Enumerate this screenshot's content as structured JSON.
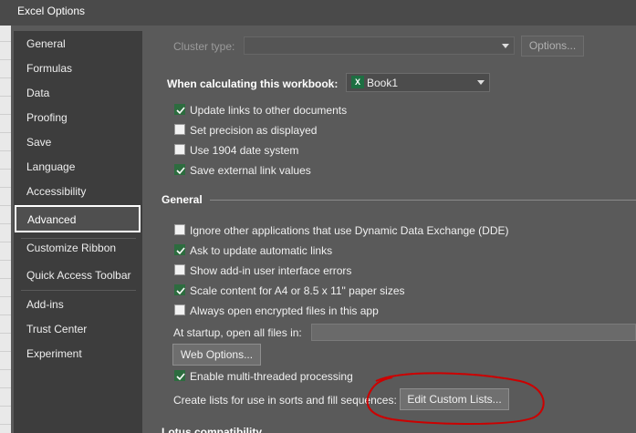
{
  "window": {
    "title": "Excel Options"
  },
  "sidebar": {
    "items": [
      {
        "label": "General"
      },
      {
        "label": "Formulas"
      },
      {
        "label": "Data"
      },
      {
        "label": "Proofing"
      },
      {
        "label": "Save"
      },
      {
        "label": "Language"
      },
      {
        "label": "Accessibility"
      },
      {
        "label": "Advanced",
        "selected": true
      },
      {
        "label": "Customize Ribbon"
      },
      {
        "label": "Quick Access Toolbar"
      },
      {
        "label": "Add-ins"
      },
      {
        "label": "Trust Center"
      },
      {
        "label": "Experiment"
      }
    ]
  },
  "cluster": {
    "label": "Cluster type:",
    "value": "",
    "options_button": "Options..."
  },
  "workbook": {
    "label": "When calculating this workbook:",
    "selected": "Book1",
    "options": [
      {
        "label": "Update links to other documents",
        "checked": true
      },
      {
        "label": "Set precision as displayed",
        "checked": false
      },
      {
        "label": "Use 1904 date system",
        "checked": false
      },
      {
        "label": "Save external link values",
        "checked": true
      }
    ]
  },
  "general": {
    "title": "General",
    "options": [
      {
        "label": "Ignore other applications that use Dynamic Data Exchange (DDE)",
        "checked": false
      },
      {
        "label": "Ask to update automatic links",
        "checked": true
      },
      {
        "label": "Show add-in user interface errors",
        "checked": false
      },
      {
        "label": "Scale content for A4 or 8.5 x 11\" paper sizes",
        "checked": true
      },
      {
        "label": "Always open encrypted files in this app",
        "checked": false
      }
    ],
    "startup_label": "At startup, open all files in:",
    "startup_value": "",
    "web_options_button": "Web Options...",
    "multithread_label": "Enable multi-threaded processing",
    "multithread_checked": true,
    "custom_lists_label": "Create lists for use in sorts and fill sequences:",
    "custom_lists_button": "Edit Custom Lists..."
  },
  "next_section": {
    "title": "Lotus compatibility"
  },
  "colors": {
    "checkbox_checked": "#2d6c3f",
    "annotation": "#cc0000",
    "selected_border": "#ffffff"
  }
}
